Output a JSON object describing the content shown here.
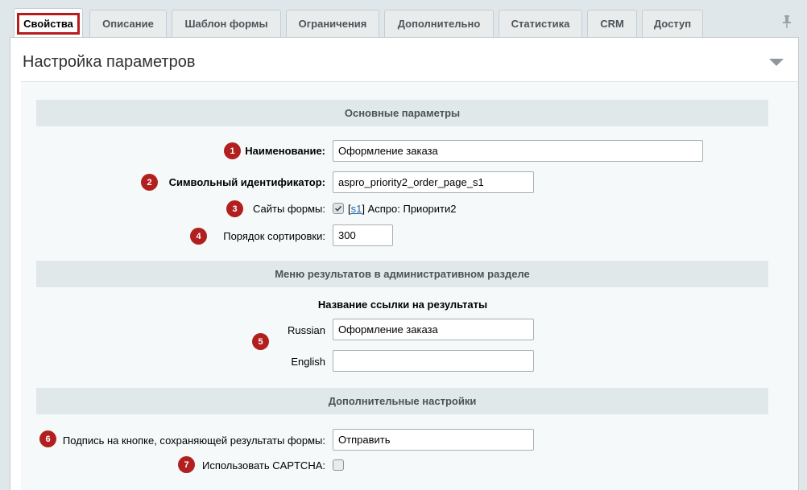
{
  "tabs": [
    {
      "label": "Свойства",
      "active": true
    },
    {
      "label": "Описание"
    },
    {
      "label": "Шаблон формы"
    },
    {
      "label": "Ограничения"
    },
    {
      "label": "Дополнительно"
    },
    {
      "label": "Статистика"
    },
    {
      "label": "CRM"
    },
    {
      "label": "Доступ"
    }
  ],
  "page_title": "Настройка параметров",
  "sections": {
    "main": {
      "title": "Основные параметры",
      "name_label": "Наименование:",
      "name_value": "Оформление заказа",
      "code_label": "Символьный идентификатор:",
      "code_value": "aspro_priority2_order_page_s1",
      "sites_label": "Сайты формы:",
      "site_link": "s1",
      "site_name": "Аспро: Приорити2",
      "sort_label": "Порядок сортировки:",
      "sort_value": "300"
    },
    "menu": {
      "title": "Меню результатов в административном разделе",
      "subtitle": "Название ссылки на результаты",
      "ru_label": "Russian",
      "ru_value": "Оформление заказа",
      "en_label": "English",
      "en_value": ""
    },
    "extra": {
      "title": "Дополнительные настройки",
      "button_label": "Подпись на кнопке, сохраняющей результаты формы:",
      "button_value": "Отправить",
      "captcha_label": "Использовать CAPTCHA:"
    }
  },
  "badges": [
    "1",
    "2",
    "3",
    "4",
    "5",
    "6",
    "7"
  ],
  "colors": {
    "badge": "#b21f1f",
    "highlight": "#b71c1c",
    "link": "#2067b0"
  }
}
